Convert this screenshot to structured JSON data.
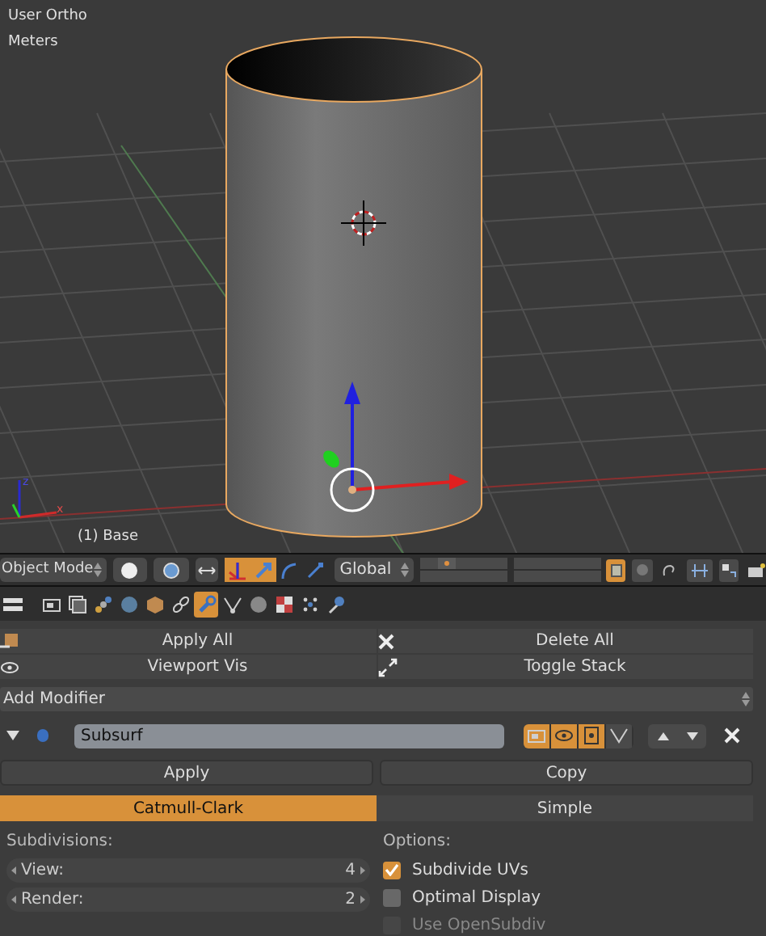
{
  "viewport": {
    "view_name": "User Ortho",
    "units": "Meters",
    "object_label": "(1) Base",
    "axis_labels": [
      "z",
      "x"
    ]
  },
  "header": {
    "mode": "Object Mode",
    "orientation": "Global",
    "manipulators": [
      {
        "kind": "axes",
        "selected": true
      },
      {
        "kind": "translate",
        "selected": true
      },
      {
        "kind": "rotate",
        "selected": false
      },
      {
        "kind": "scale",
        "selected": false
      }
    ],
    "layers": [
      {
        "selected": false
      },
      {
        "selected": true
      },
      {
        "selected": false
      },
      {
        "selected": false
      },
      {
        "selected": false
      },
      {
        "selected": false
      },
      {
        "selected": false
      },
      {
        "selected": false
      },
      {
        "selected": false
      },
      {
        "selected": false
      },
      {
        "selected": false
      },
      {
        "selected": false
      },
      {
        "selected": false
      },
      {
        "selected": false
      },
      {
        "selected": false
      },
      {
        "selected": false
      },
      {
        "selected": false
      },
      {
        "selected": false
      },
      {
        "selected": false
      },
      {
        "selected": false
      }
    ],
    "lock_layers": {
      "selected": true
    }
  },
  "property_tabs": [
    {
      "kind": "render",
      "selected": false
    },
    {
      "kind": "layers",
      "selected": false
    },
    {
      "kind": "scene",
      "selected": false
    },
    {
      "kind": "world",
      "selected": false
    },
    {
      "kind": "object",
      "selected": false
    },
    {
      "kind": "constraints",
      "selected": false
    },
    {
      "kind": "modifiers",
      "selected": true
    },
    {
      "kind": "data",
      "selected": false
    },
    {
      "kind": "material",
      "selected": false
    },
    {
      "kind": "texture",
      "selected": false
    },
    {
      "kind": "particles",
      "selected": false
    },
    {
      "kind": "physics",
      "selected": false
    }
  ],
  "stack_tools": [
    {
      "label": "Apply All",
      "kind": "apply"
    },
    {
      "label": "Delete All",
      "kind": "delete"
    },
    {
      "label": "Viewport Vis",
      "kind": "eye"
    },
    {
      "label": "Toggle Stack",
      "kind": "expand"
    }
  ],
  "add_modifier": "Add Modifier",
  "modifier": {
    "name": "Subsurf",
    "expanded": true,
    "toggles": [
      {
        "kind": "render",
        "on": true
      },
      {
        "kind": "viewport",
        "on": true
      },
      {
        "kind": "editmode",
        "on": true
      },
      {
        "kind": "cage",
        "on": false
      }
    ],
    "actions": [
      "Apply",
      "Copy"
    ],
    "types": [
      {
        "label": "Catmull-Clark",
        "selected": true
      },
      {
        "label": "Simple",
        "selected": false
      }
    ],
    "subdivisions_label": "Subdivisions:",
    "fields": [
      {
        "label": "View:",
        "value": "4"
      },
      {
        "label": "Render:",
        "value": "2"
      }
    ],
    "options_label": "Options:",
    "options": [
      {
        "label": "Subdivide UVs",
        "checked": true,
        "disabled": false
      },
      {
        "label": "Optimal Display",
        "checked": false,
        "disabled": false
      },
      {
        "label": "Use OpenSubdiv",
        "checked": false,
        "disabled": true
      }
    ]
  }
}
